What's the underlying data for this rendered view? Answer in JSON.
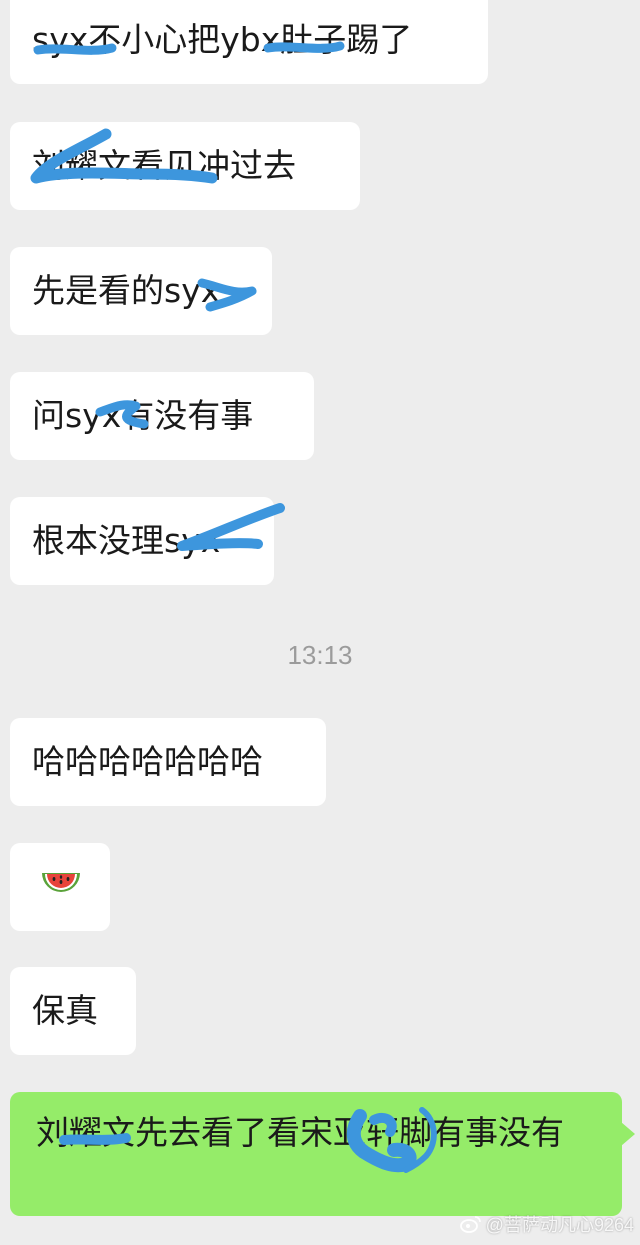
{
  "chat": {
    "messages": [
      {
        "sender": "other",
        "text": "syx不小心把ybx肚子踢了"
      },
      {
        "sender": "other",
        "text": "刘耀文看见冲过去"
      },
      {
        "sender": "other",
        "text": "先是看的syx"
      },
      {
        "sender": "other",
        "text": "问syx有没有事"
      },
      {
        "sender": "other",
        "text": "根本没理syx"
      },
      {
        "sender": "other",
        "text": "哈哈哈哈哈哈哈"
      },
      {
        "sender": "other",
        "emoji": "watermelon-icon"
      },
      {
        "sender": "other",
        "text": "保真"
      },
      {
        "sender": "self",
        "text": "刘耀文先去看了看宋亚轩脚有事没有"
      }
    ],
    "timestamp": "13:13"
  },
  "colors": {
    "background": "#ededed",
    "incoming_bubble": "#ffffff",
    "outgoing_bubble": "#95ec69",
    "redaction_scribble": "#3d96dd"
  },
  "watermark": {
    "icon": "weibo-logo-icon",
    "text": "@菩萨动凡心9264"
  }
}
